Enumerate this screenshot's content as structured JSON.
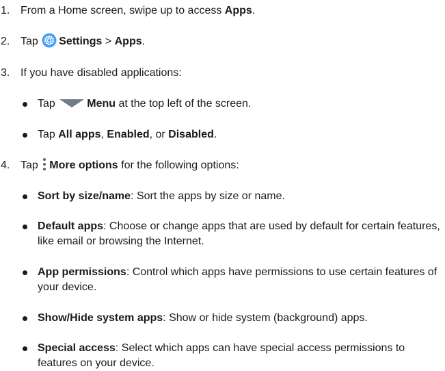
{
  "steps": [
    {
      "num": "1.",
      "pre": "From a Home screen, swipe up to access ",
      "b1": "Apps",
      "post": "."
    },
    {
      "num": "2.",
      "pre": "Tap ",
      "b1": "Settings",
      "mid": " > ",
      "b2": "Apps",
      "post": "."
    },
    {
      "num": "3.",
      "text": "If you have disabled applications:"
    },
    {
      "num": "4.",
      "pre": "Tap ",
      "b1": "More options",
      "post": " for the following options:"
    }
  ],
  "sub3": [
    {
      "pre": "Tap ",
      "b1": "Menu",
      "post": " at the top left of the screen."
    },
    {
      "pre": "Tap ",
      "b1": "All apps",
      "m1": ", ",
      "b2": "Enabled",
      "m2": ", or ",
      "b3": "Disabled",
      "post": "."
    }
  ],
  "sub4": [
    {
      "b": "Sort by size/name",
      "text": ": Sort the apps by size or name."
    },
    {
      "b": "Default apps",
      "text": ": Choose or change apps that are used by default for certain features, like email or browsing the Internet."
    },
    {
      "b": "App permissions",
      "text": ": Control which apps have permissions to use certain features of your device."
    },
    {
      "b": "Show/Hide system apps",
      "text": ": Show or hide system (background) apps."
    },
    {
      "b": "Special access",
      "text": ": Select which apps can have special access permissions to features on your device."
    }
  ],
  "icons": {
    "settings": "gear-icon",
    "menu": "dropdown-triangle-icon",
    "more": "vertical-dots-icon",
    "settings_color": "#4a9ff5"
  }
}
